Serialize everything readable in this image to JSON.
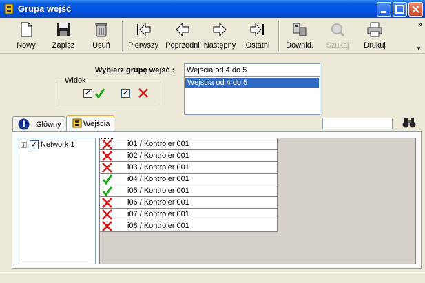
{
  "window": {
    "title": "Grupa wejść"
  },
  "toolbar": {
    "buttons": [
      {
        "label": "Nowy",
        "icon": "new-document-icon"
      },
      {
        "label": "Zapisz",
        "icon": "floppy-disk-icon"
      },
      {
        "label": "Usuń",
        "icon": "trash-can-icon"
      },
      {
        "label": "Pierwszy",
        "icon": "first-arrow-icon"
      },
      {
        "label": "Poprzedni",
        "icon": "left-arrow-icon"
      },
      {
        "label": "Następny",
        "icon": "right-arrow-icon"
      },
      {
        "label": "Ostatni",
        "icon": "last-arrow-icon"
      },
      {
        "label": "Downld.",
        "icon": "download-icon"
      },
      {
        "label": "Szukaj",
        "icon": "search-icon",
        "disabled": true
      },
      {
        "label": "Drukuj",
        "icon": "printer-icon"
      }
    ],
    "overflow": "»"
  },
  "group_select": {
    "label": "Wybierz grupę wejść :",
    "value": "Wejścia od 4 do 5",
    "options": [
      "Wejścia od 4 do 5"
    ]
  },
  "widok": {
    "label": "Widok",
    "show_ok": true,
    "show_error": true
  },
  "tabs": [
    {
      "label": "Główny",
      "icon": "info-icon",
      "active": false
    },
    {
      "label": "Wejścia",
      "icon": "io-icon",
      "active": true
    }
  ],
  "search": {
    "value": ""
  },
  "tree": {
    "nodes": [
      {
        "label": "Network 1",
        "checked": true,
        "expand": "+"
      }
    ]
  },
  "inputs": [
    {
      "name": "i01 / Kontroler 001",
      "status": "error"
    },
    {
      "name": "i02 / Kontroler 001",
      "status": "error"
    },
    {
      "name": "i03 / Kontroler 001",
      "status": "error"
    },
    {
      "name": "i04 / Kontroler 001",
      "status": "ok"
    },
    {
      "name": "i05 / Kontroler 001",
      "status": "ok"
    },
    {
      "name": "i06 / Kontroler 001",
      "status": "error"
    },
    {
      "name": "i07 / Kontroler 001",
      "status": "error"
    },
    {
      "name": "i08 / Kontroler 001",
      "status": "error"
    }
  ],
  "colors": {
    "ok": "#1aa81a",
    "error": "#e01818",
    "selection": "#316ac5",
    "titlebar": "#0054e3"
  }
}
